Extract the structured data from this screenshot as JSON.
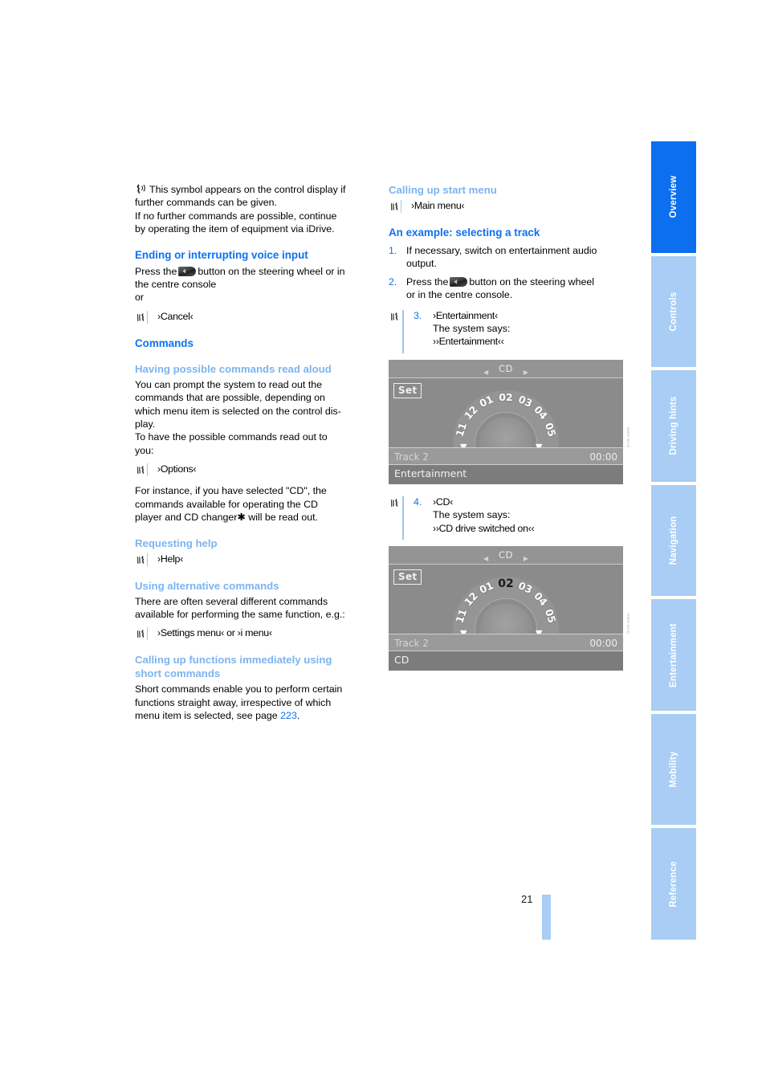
{
  "document": {
    "page_number": "21"
  },
  "tabs": [
    {
      "label": "Overview",
      "active": true
    },
    {
      "label": "Controls",
      "active": false
    },
    {
      "label": "Driving hints",
      "active": false
    },
    {
      "label": "Navigation",
      "active": false
    },
    {
      "label": "Entertainment",
      "active": false
    },
    {
      "label": "Mobility",
      "active": false
    },
    {
      "label": "Reference",
      "active": false
    }
  ],
  "colors": {
    "heading_main": "#0d72f0",
    "heading_sub": "#7cb4f0",
    "tab_active": "#0b6ff0",
    "tab_inactive": "#a9cdf4",
    "link": "#0d72f0"
  },
  "left_column": {
    "intro": {
      "line1": "This symbol appears on the control display if",
      "line2": "further commands can be given.",
      "line3": "If no further commands are possible, continue",
      "line4": "by operating the item of equipment via iDrive."
    },
    "ending_section": {
      "heading": "Ending or interrupting voice input",
      "text_before_button": "Press the",
      "text_after_button": "button on the steering wheel or in",
      "text_line2": "the centre console",
      "text_or": "or",
      "command": "›Cancel‹"
    },
    "commands_section": {
      "heading": "Commands",
      "read_aloud": {
        "heading": "Having possible commands read aloud",
        "para1_line1": "You can prompt the system to read out the",
        "para1_line2": "commands that are possible, depending on",
        "para1_line3": "which menu item is selected on the control dis-",
        "para1_line4": "play.",
        "para2_line1": "To have the possible commands read out to",
        "para2_line2": "you:",
        "command": "›Options‹",
        "para3_line1": "For instance, if you have selected \"CD\", the",
        "para3_line2": "commands available for operating the CD",
        "para3_line3": "player and CD changer✱ will be read out."
      },
      "requesting_help": {
        "heading": "Requesting help",
        "command": "›Help‹"
      },
      "alternative": {
        "heading": "Using alternative commands",
        "para_line1": "There are often several different commands",
        "para_line2": "available for performing the same function, e.g.:",
        "command": "›Settings menu‹  or ›i menu‹"
      },
      "short_commands": {
        "heading_line1": "Calling up functions immediately using",
        "heading_line2": "short commands",
        "para_line1": "Short commands enable you to perform certain",
        "para_line2": "functions straight away, irrespective of which",
        "para_line3_before": "menu item is selected, see page",
        "page_ref": "223",
        "para_line3_after": "."
      }
    }
  },
  "right_column": {
    "start_menu": {
      "heading": "Calling up start menu",
      "command": "›Main menu‹"
    },
    "example": {
      "heading": "An example: selecting a track",
      "steps": [
        {
          "number": "1.",
          "line1": "If necessary, switch on entertainment audio",
          "line2": "output."
        },
        {
          "number": "2.",
          "text_before_button": "Press the",
          "text_after_button": "button on the steering wheel",
          "line2": "or in the centre console."
        },
        {
          "number": "3.",
          "command": "›Entertainment‹",
          "says_label": "The system says:",
          "says_text": "››Entertainment‹‹"
        },
        {
          "number": "4.",
          "command": "›CD‹",
          "says_label": "The system says:",
          "says_text": "››CD drive switched on‹‹"
        }
      ]
    },
    "display_1": {
      "header_title": "CD",
      "set_label": "Set",
      "track_label": "Track 2",
      "time": "00:00",
      "footer_label": "Entertainment",
      "dial_numbers": [
        "11",
        "12",
        "01",
        "02",
        "03",
        "04",
        "05"
      ],
      "selected_index": null
    },
    "display_2": {
      "header_title": "CD",
      "set_label": "Set",
      "track_label": "Track 2",
      "time": "00:00",
      "footer_label": "CD",
      "dial_numbers": [
        "11",
        "12",
        "01",
        "02",
        "03",
        "04",
        "05"
      ],
      "selected_index": 3
    }
  }
}
